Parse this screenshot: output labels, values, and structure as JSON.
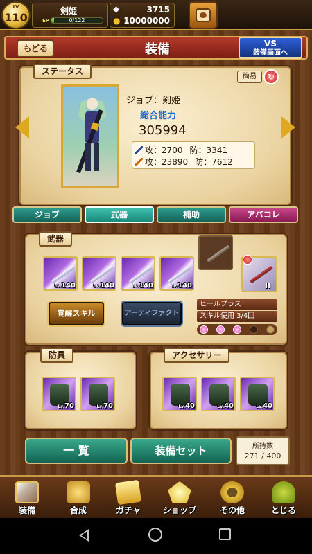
{
  "player": {
    "level_label": "LV",
    "level": "110",
    "name": "剣姫",
    "ep_label": "EP",
    "ep_text": "0/122",
    "ep_progress": 0.05,
    "gems": "3715",
    "gold": "10000000"
  },
  "header": {
    "back_label": "もどる",
    "title": "装備",
    "vs_line1": "VS",
    "vs_line2": "装備画面へ"
  },
  "status": {
    "tag": "ステータス",
    "simple_label": "簡易",
    "job_line": "ジョブ：剣姫",
    "power_label": "総合能力",
    "power_value": "305994",
    "stat_row1_a": "攻：2700",
    "stat_row1_b": "防：3341",
    "stat_row2_a": "攻：23890",
    "stat_row2_b": "防：7612"
  },
  "tabs": [
    {
      "label": "ジョブ"
    },
    {
      "label": "武器"
    },
    {
      "label": "補助"
    },
    {
      "label": "アバコレ"
    }
  ],
  "weapons": {
    "tag": "武器",
    "slots": [
      {
        "lv_prefix": "Lv.",
        "lv": "140"
      },
      {
        "lv_prefix": "Lv.",
        "lv": "140"
      },
      {
        "lv_prefix": "Lv.",
        "lv": "140"
      },
      {
        "lv_prefix": "Lv.",
        "lv": "140"
      }
    ],
    "special_slot_mark": "II",
    "awaken_label": "覚醒スキル",
    "artifact_label": "アーティファクト",
    "skill_name": "ヒールプラス",
    "skill_uses": "スキル使用 3/4回",
    "skill_uses_filled": 3,
    "skill_uses_total": 4
  },
  "armor": {
    "tag": "防具",
    "slots": [
      {
        "lv_prefix": "Lv.",
        "lv": "70"
      },
      {
        "lv_prefix": "Lv.",
        "lv": "70"
      }
    ]
  },
  "accessory": {
    "tag": "アクセサリー",
    "slots": [
      {
        "lv_prefix": "Lv.",
        "lv": "40"
      },
      {
        "lv_prefix": "Lv.",
        "lv": "40"
      },
      {
        "lv_prefix": "Lv.",
        "lv": "40"
      }
    ]
  },
  "actions": {
    "list_label": "一 覧",
    "set_label": "装備セット",
    "owned_label": "所持数",
    "owned_value": "271 / 400"
  },
  "nav": [
    {
      "label": "装備",
      "icon": "sword-shield-icon"
    },
    {
      "label": "合成",
      "icon": "hammer-icon"
    },
    {
      "label": "ガチャ",
      "icon": "gacha-icon"
    },
    {
      "label": "ショップ",
      "icon": "crystal-icon"
    },
    {
      "label": "その他",
      "icon": "gear-icon"
    },
    {
      "label": "とじる",
      "icon": "frog-icon"
    }
  ],
  "colors": {
    "header_red": "#b23a2a",
    "tab_teal": "#2f9a8e",
    "tab_pink": "#c8488a",
    "power_blue": "#1f68c8"
  }
}
